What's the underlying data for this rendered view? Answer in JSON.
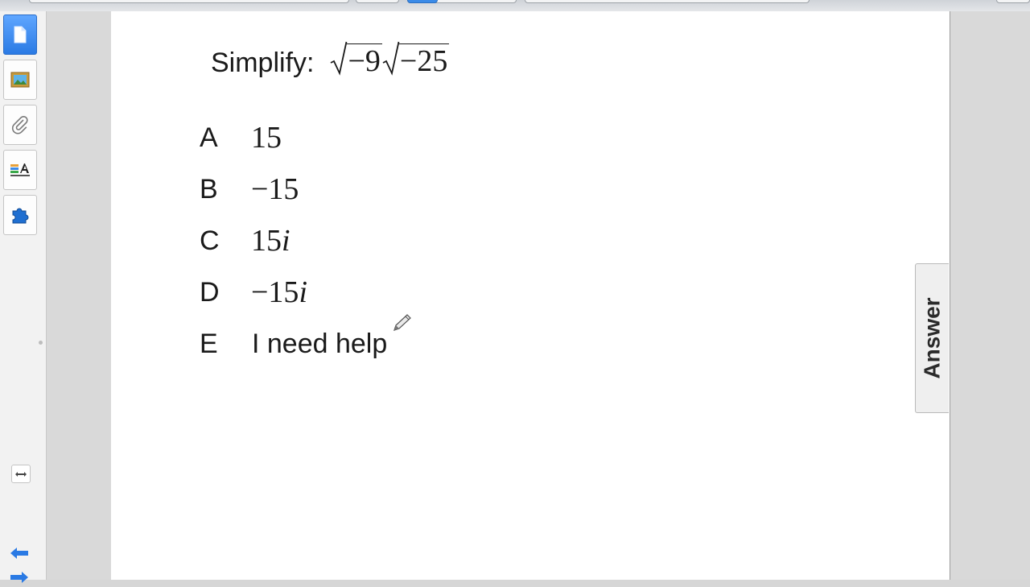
{
  "question": {
    "label": "Simplify:",
    "radicand_1": "−9",
    "radicand_2": "−25"
  },
  "options": [
    {
      "letter": "A",
      "value": "15",
      "imaginary_unit": ""
    },
    {
      "letter": "B",
      "value": "−15",
      "imaginary_unit": ""
    },
    {
      "letter": "C",
      "value": "15",
      "imaginary_unit": "i"
    },
    {
      "letter": "D",
      "value": "−15",
      "imaginary_unit": "i"
    },
    {
      "letter": "E",
      "text": "I need help"
    }
  ],
  "answer_tab": {
    "label": "Answer"
  },
  "sidebar": {
    "tools": [
      {
        "icon": "page-sorter-icon",
        "active": true
      },
      {
        "icon": "gallery-icon",
        "active": false
      },
      {
        "icon": "attachments-icon",
        "active": false
      },
      {
        "icon": "properties-icon",
        "active": false
      },
      {
        "icon": "add-ons-icon",
        "active": false
      }
    ],
    "expand_icon": "expand-arrows-icon",
    "nav_icons": [
      "previous-page-icon",
      "next-page-icon"
    ]
  },
  "colors": {
    "active_tool": "#2a7ae4",
    "page": "#ffffff",
    "workspace": "#d9d9d9",
    "text": "#1a1a1a"
  }
}
